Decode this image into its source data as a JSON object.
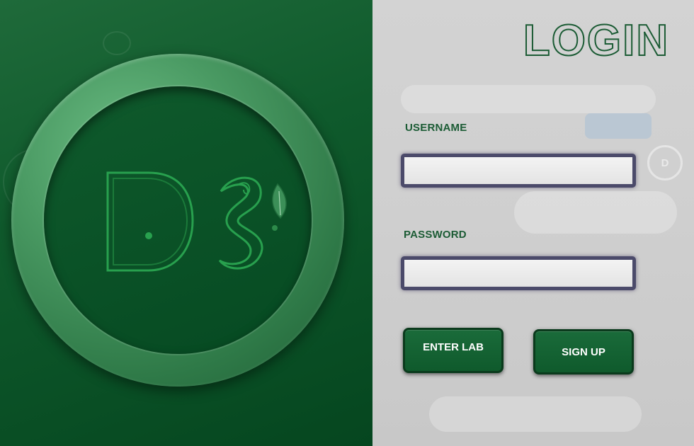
{
  "brand": {
    "logo_icon": "ds-leaf-logo-icon",
    "ring_color": "#4a9a63",
    "panel_color": "#0f5a2c"
  },
  "login": {
    "title": "LOGIN",
    "username_label": "USERNAME",
    "username_value": "",
    "password_label": "PASSWORD",
    "password_value": "",
    "enter_button": "ENTER LAB",
    "signup_button": "SIGN UP"
  },
  "colors": {
    "accent": "#0f5a2c",
    "label": "#1c5c35",
    "input_border": "#4b4a6a"
  }
}
